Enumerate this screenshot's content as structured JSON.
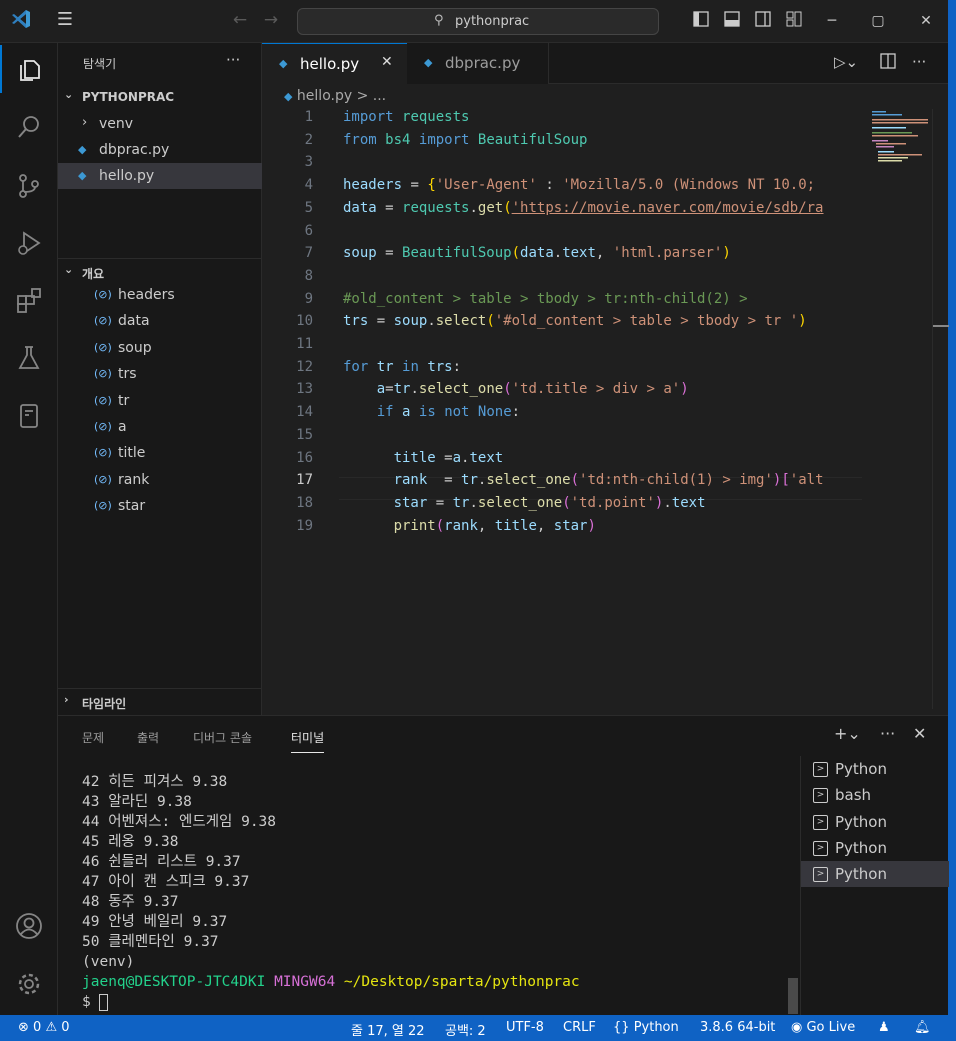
{
  "titlebar": {
    "search_text": "pythonprac",
    "logo_icon": "vscode-logo",
    "back_icon": "arrow-left-icon",
    "forward_icon": "arrow-right-icon"
  },
  "sidebar": {
    "title": "탐색기",
    "more": "···",
    "project": "PYTHONPRAC",
    "files": [
      {
        "label": "venv"
      },
      {
        "label": "dbprac.py"
      },
      {
        "label": "hello.py"
      }
    ],
    "outline_title": "개요",
    "outline": [
      "headers",
      "data",
      "soup",
      "trs",
      "tr",
      "a",
      "title",
      "rank",
      "star"
    ],
    "timeline_title": "타임라인"
  },
  "editor": {
    "tabs": [
      {
        "label": "hello.py",
        "close": "✕"
      },
      {
        "label": "dbprac.py"
      }
    ],
    "breadcrumb": "hello.py > ...",
    "current_line": 17
  },
  "panel": {
    "tabs": [
      "문제",
      "출력",
      "디버그 콘솔",
      "터미널"
    ],
    "terminal_lines": [
      "42 히든 피겨스 9.38",
      "43 알라딘 9.38",
      "44 어벤져스: 엔드게임 9.38",
      "45 레옹 9.38",
      "46 쉰들러 리스트 9.37",
      "47 아이 캔 스피크 9.37",
      "48 동주 9.37",
      "49 안녕 베일리 9.37",
      "50 클레멘타인 9.37",
      "(venv)"
    ],
    "prompt": {
      "user": "jaenq@DESKTOP-JTC4DKI",
      "env": "MINGW64",
      "path": "~/Desktop/sparta/pythonprac",
      "cursor": "$ "
    },
    "terminals": [
      {
        "label": "Python"
      },
      {
        "label": "bash"
      },
      {
        "label": "Python"
      },
      {
        "label": "Python"
      },
      {
        "label": "Python"
      }
    ]
  },
  "status": {
    "errors": "0",
    "warnings": "0",
    "position": "줄 17, 열 22",
    "spaces": "공백: 2",
    "encoding": "UTF-8",
    "eol": "CRLF",
    "language": "Python",
    "interpreter": "3.8.6 64-bit",
    "golive": "Go Live"
  },
  "colors": {
    "accent": "#0078d4",
    "statusbar": "#0f62c4",
    "keyword": "#569cd6",
    "string": "#ce9178",
    "function": "#dcdcaa",
    "variable": "#9cdcfe",
    "comment": "#6a9955"
  },
  "code": [
    [
      [
        "kw",
        "import"
      ],
      [
        "p",
        " "
      ],
      [
        "mod",
        "requests"
      ]
    ],
    [
      [
        "kw",
        "from"
      ],
      [
        "p",
        " "
      ],
      [
        "mod",
        "bs4"
      ],
      [
        "p",
        " "
      ],
      [
        "kw",
        "import"
      ],
      [
        "p",
        " "
      ],
      [
        "cls",
        "BeautifulSoup"
      ]
    ],
    [],
    [
      [
        "v",
        "headers"
      ],
      [
        "p",
        " = "
      ],
      [
        "br",
        "{"
      ],
      [
        "s",
        "'User-Agent'"
      ],
      [
        "p",
        " : "
      ],
      [
        "s",
        "'Mozilla/5.0 (Windows NT 10.0;"
      ]
    ],
    [
      [
        "v",
        "data"
      ],
      [
        "p",
        " = "
      ],
      [
        "mod",
        "requests"
      ],
      [
        "p",
        "."
      ],
      [
        "fn",
        "get"
      ],
      [
        "br",
        "("
      ],
      [
        "url",
        "'https://movie.naver.com/movie/sdb/ra"
      ]
    ],
    [],
    [
      [
        "v",
        "soup"
      ],
      [
        "p",
        " = "
      ],
      [
        "cls",
        "BeautifulSoup"
      ],
      [
        "br",
        "("
      ],
      [
        "v",
        "data"
      ],
      [
        "p",
        "."
      ],
      [
        "v",
        "text"
      ],
      [
        "p",
        ", "
      ],
      [
        "s",
        "'html.parser'"
      ],
      [
        "br",
        ")"
      ]
    ],
    [],
    [
      [
        "c",
        "#old_content > table > tbody > tr:nth-child(2) >"
      ]
    ],
    [
      [
        "v",
        "trs"
      ],
      [
        "p",
        " = "
      ],
      [
        "v",
        "soup"
      ],
      [
        "p",
        "."
      ],
      [
        "fn",
        "select"
      ],
      [
        "br",
        "("
      ],
      [
        "s",
        "'#old_content > table > tbody > tr '"
      ],
      [
        "br",
        ")"
      ]
    ],
    [],
    [
      [
        "kw2",
        "for"
      ],
      [
        "p",
        " "
      ],
      [
        "v",
        "tr"
      ],
      [
        "p",
        " "
      ],
      [
        "kw2",
        "in"
      ],
      [
        "p",
        " "
      ],
      [
        "v",
        "trs"
      ],
      [
        "p",
        ":"
      ]
    ],
    [
      [
        "p",
        "    "
      ],
      [
        "v",
        "a"
      ],
      [
        "p",
        "="
      ],
      [
        "v",
        "tr"
      ],
      [
        "p",
        "."
      ],
      [
        "fn",
        "select_one"
      ],
      [
        "br2",
        "("
      ],
      [
        "s",
        "'td.title > div > a'"
      ],
      [
        "br2",
        ")"
      ]
    ],
    [
      [
        "p",
        "    "
      ],
      [
        "kw2",
        "if"
      ],
      [
        "p",
        " "
      ],
      [
        "v",
        "a"
      ],
      [
        "p",
        " "
      ],
      [
        "kw",
        "is"
      ],
      [
        "p",
        " "
      ],
      [
        "kw",
        "not"
      ],
      [
        "p",
        " "
      ],
      [
        "kw",
        "None"
      ],
      [
        "p",
        ":"
      ]
    ],
    [],
    [
      [
        "p",
        "      "
      ],
      [
        "v",
        "title"
      ],
      [
        "p",
        " ="
      ],
      [
        "v",
        "a"
      ],
      [
        "p",
        "."
      ],
      [
        "v",
        "text"
      ]
    ],
    [
      [
        "p",
        "      "
      ],
      [
        "v",
        "rank"
      ],
      [
        "p",
        "  = "
      ],
      [
        "v",
        "tr"
      ],
      [
        "p",
        "."
      ],
      [
        "fn",
        "select_one"
      ],
      [
        "br2",
        "("
      ],
      [
        "s",
        "'td:nth-child(1) > img'"
      ],
      [
        "br2",
        ")"
      ],
      [
        "br2",
        "["
      ],
      [
        "s",
        "'alt"
      ]
    ],
    [
      [
        "p",
        "      "
      ],
      [
        "v",
        "star"
      ],
      [
        "p",
        " = "
      ],
      [
        "v",
        "tr"
      ],
      [
        "p",
        "."
      ],
      [
        "fn",
        "select_one"
      ],
      [
        "br2",
        "("
      ],
      [
        "s",
        "'td.point'"
      ],
      [
        "br2",
        ")"
      ],
      [
        "p",
        "."
      ],
      [
        "v",
        "text"
      ]
    ],
    [
      [
        "p",
        "      "
      ],
      [
        "fn",
        "print"
      ],
      [
        "br2",
        "("
      ],
      [
        "v",
        "rank"
      ],
      [
        "p",
        ", "
      ],
      [
        "v",
        "title"
      ],
      [
        "p",
        ", "
      ],
      [
        "v",
        "star"
      ],
      [
        "br2",
        ")"
      ]
    ]
  ]
}
